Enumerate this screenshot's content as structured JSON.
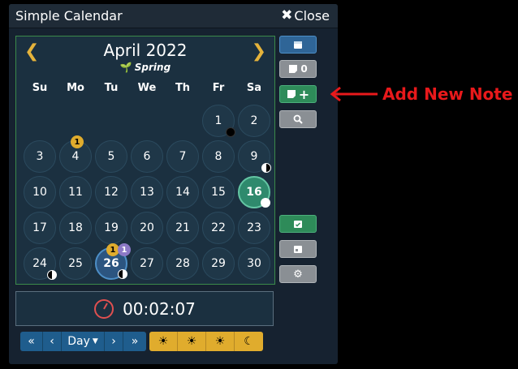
{
  "window": {
    "title": "Simple Calendar",
    "close_label": "Close"
  },
  "calendar": {
    "month_label": "April 2022",
    "season": "Spring",
    "weekdays": [
      "Su",
      "Mo",
      "Tu",
      "We",
      "Th",
      "Fr",
      "Sa"
    ],
    "days": [
      "1",
      "2",
      "3",
      "4",
      "5",
      "6",
      "7",
      "8",
      "9",
      "10",
      "11",
      "12",
      "13",
      "14",
      "15",
      "16",
      "17",
      "18",
      "19",
      "20",
      "21",
      "22",
      "23",
      "24",
      "25",
      "26",
      "27",
      "28",
      "29",
      "30"
    ],
    "note_badges": {
      "day4": "1",
      "day26_gold": "1",
      "day26_purple": "1"
    }
  },
  "clock": {
    "time": "00:02:07"
  },
  "controls": {
    "view_label": "Day"
  },
  "sidebar": {
    "notes_count": "0"
  },
  "annotation": {
    "label": "Add New Note"
  },
  "colors": {
    "accent_gold": "#e0ac2d",
    "today": "#2f8a6d",
    "selected": "#2c5580",
    "arrow": "#e8191b"
  }
}
